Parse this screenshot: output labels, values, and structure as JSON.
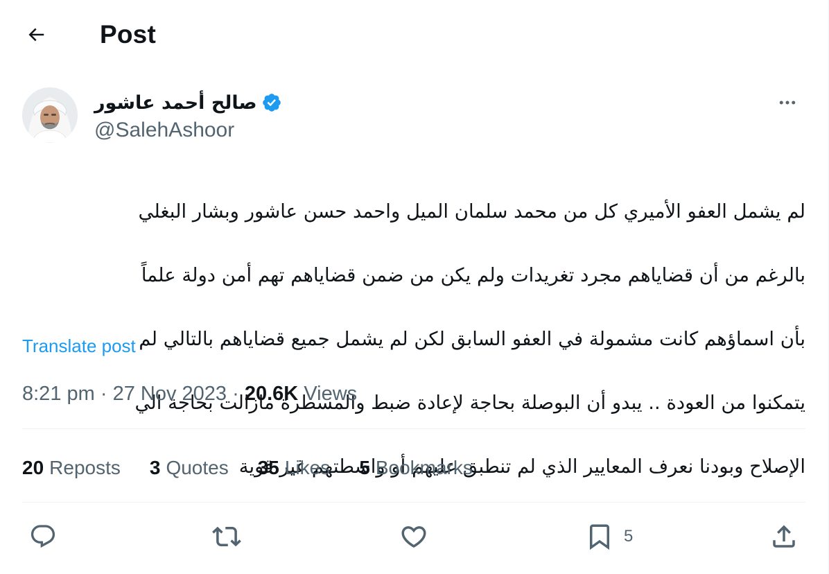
{
  "header": {
    "title": "Post"
  },
  "author": {
    "name": "صالح أحمد عاشور",
    "handle": "@SalehAshoor",
    "verified": true
  },
  "tweet": {
    "lines": [
      "لم يشمل العفو الأميري كل من محمد سلمان الميل واحمد حسن عاشور وبشار البغلي",
      "بالرغم من أن قضاياهم مجرد تغريدات ولم يكن من ضمن قضاياهم تهم أمن دولة علماً",
      "بأن اسماؤهم كانت مشمولة في العفو السابق لكن لم يشمل جميع قضاياهم بالتالي لم",
      "يتمكنوا من العودة .. يبدو أن البوصلة بحاجة لإعادة ضبط والمسطرة مازالت بحاجة الي",
      "الإصلاح وبودنا نعرف المعايير الذي لم تنطبق عليهم أو واسطتهم غير قوية"
    ],
    "translate_label": "Translate post"
  },
  "meta": {
    "time": "8:21 pm",
    "separator": "·",
    "date": "27 Nov 2023",
    "views_count": "20.6K",
    "views_label": "Views"
  },
  "stats": {
    "reposts": {
      "count": "20",
      "label": "Reposts"
    },
    "quotes": {
      "count": "3",
      "label": "Quotes"
    },
    "likes": {
      "count": "35",
      "label": "Likes"
    },
    "bookmarks": {
      "count": "5",
      "label": "Bookmarks"
    }
  },
  "actions": {
    "bookmark_count": "5"
  },
  "icons": {
    "back": "arrow-left-icon",
    "verified": "verified-badge-icon",
    "more": "more-horizontal-icon",
    "reply": "reply-icon",
    "repost": "repost-icon",
    "like": "heart-icon",
    "bookmark": "bookmark-icon",
    "share": "share-icon"
  },
  "colors": {
    "accent": "#1d9bf0",
    "text_primary": "#0f1419",
    "text_secondary": "#536471",
    "divider": "#eff3f4"
  }
}
